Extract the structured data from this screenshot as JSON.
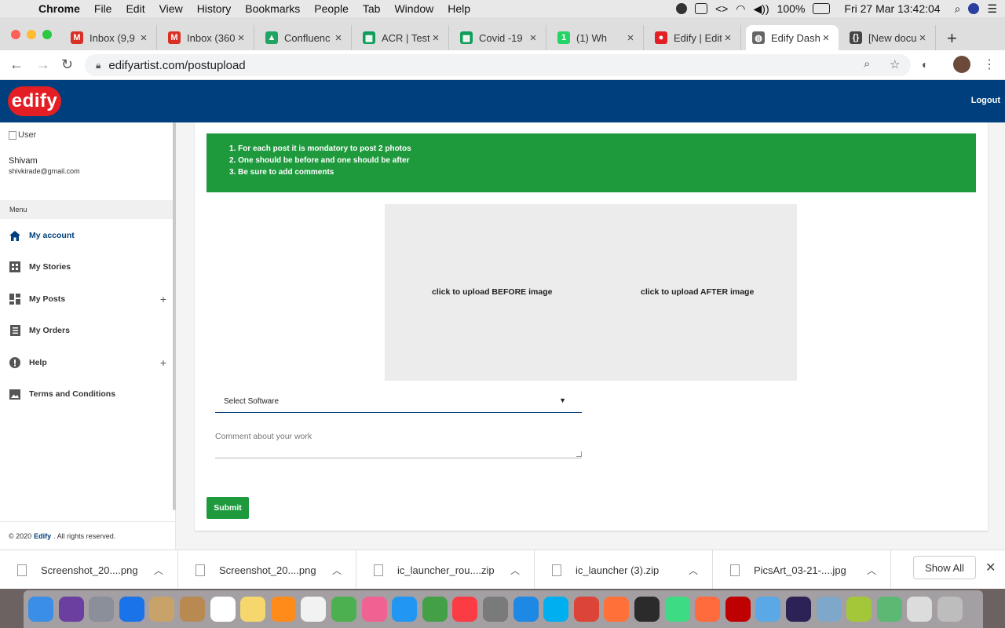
{
  "menubar": {
    "app": "Chrome",
    "items": [
      "File",
      "Edit",
      "View",
      "History",
      "Bookmarks",
      "People",
      "Tab",
      "Window",
      "Help"
    ],
    "battery": "100%",
    "datetime": "Fri 27 Mar  13:42:04"
  },
  "tabs": [
    {
      "title": "Inbox (9,9",
      "icon": "gmail-icon",
      "color": "#d93025"
    },
    {
      "title": "Inbox (360",
      "icon": "gmail-icon",
      "color": "#d93025"
    },
    {
      "title": "Confluenc",
      "icon": "drive-icon",
      "color": "#1fa463"
    },
    {
      "title": "ACR | Test",
      "icon": "sheets-icon",
      "color": "#0f9d58"
    },
    {
      "title": "Covid -19",
      "icon": "sheets-icon",
      "color": "#0f9d58"
    },
    {
      "title": "(1) Wh",
      "icon": "whatsapp-icon",
      "color": "#25d366"
    },
    {
      "title": "Edify | Edit",
      "icon": "edify-icon",
      "color": "#e31e24"
    },
    {
      "title": "Edify Dash",
      "icon": "globe-icon",
      "color": "#666666"
    },
    {
      "title": "[New docu",
      "icon": "braces-icon",
      "color": "#444444"
    }
  ],
  "address": {
    "url": "edifyartist.com/postupload"
  },
  "site": {
    "logo": "edify",
    "logout": "Logout"
  },
  "sidebar": {
    "user_img_alt": "User",
    "name": "Shivam",
    "email": "shivkirade@gmail.com",
    "menu_title": "Menu",
    "items": [
      {
        "label": "My account",
        "icon": "home-icon",
        "plus": ""
      },
      {
        "label": "My Stories",
        "icon": "stories-icon",
        "plus": ""
      },
      {
        "label": "My Posts",
        "icon": "dashboard-icon",
        "plus": "+"
      },
      {
        "label": "My Orders",
        "icon": "list-icon",
        "plus": ""
      },
      {
        "label": "Help",
        "icon": "alert-icon",
        "plus": "+"
      },
      {
        "label": "Terms and Conditions",
        "icon": "image-icon",
        "plus": ""
      }
    ],
    "copyright_pre": "© 2020",
    "copyright_brand": "Edify",
    "copyright_post": ". All rights reserved."
  },
  "main": {
    "instructions": [
      "1. For each post it is mondatory to post 2 photos",
      "2. One should be before and one should be after",
      "3. Be sure to add comments"
    ],
    "before_label": "click to upload BEFORE image",
    "after_label": "click to upload AFTER image",
    "select_value": "Select Software",
    "comment_placeholder": "Comment about your work",
    "submit": "Submit"
  },
  "downloads": [
    "Screenshot_20....png",
    "Screenshot_20....png",
    "ic_launcher_rou....zip",
    "ic_launcher (3).zip",
    "PicsArt_03-21-....jpg"
  ],
  "show_all": "Show All",
  "colors": {
    "brand_blue": "#003f7d",
    "brand_green": "#1e9a3d",
    "logo_red": "#e31e24"
  }
}
